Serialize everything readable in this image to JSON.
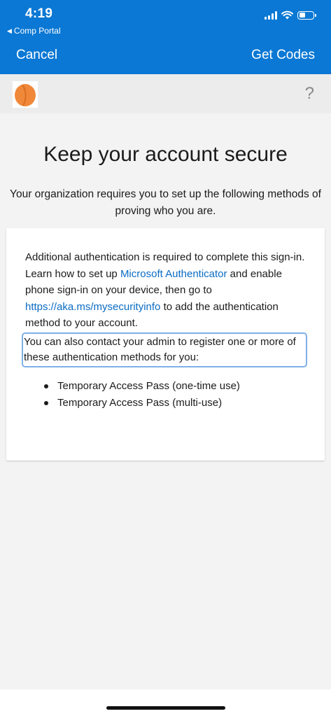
{
  "status_bar": {
    "time": "4:19",
    "back_app": "Comp Portal",
    "back_arrow": "◀"
  },
  "nav": {
    "cancel_label": "Cancel",
    "get_codes_label": "Get Codes"
  },
  "header": {
    "logo_icon": "orange-logo-icon",
    "help_glyph": "?"
  },
  "main": {
    "title": "Keep your account secure",
    "subtitle": "Your organization requires you to set up the following methods of proving who you are.",
    "card": {
      "para1_text1": "Additional authentication is required to complete this sign-in. Learn how to set up ",
      "link_authenticator": "Microsoft Authenticator",
      "para1_text2": " and enable phone sign-in on your device, then go to ",
      "link_mysecurityinfo": "https://aka.ms/mysecurityinfo",
      "para1_text3": " to add the authentication method to your account.",
      "para2": "You can also contact your admin to register one or more of these authentication methods for you:",
      "methods": [
        "Temporary Access Pass (one-time use)",
        "Temporary Access Pass (multi-use)"
      ]
    }
  },
  "colors": {
    "brand_blue": "#0a78d4",
    "link_blue": "#0a6cc4",
    "focus_outline": "#7fb0e6",
    "logo_orange": "#f0883a"
  }
}
